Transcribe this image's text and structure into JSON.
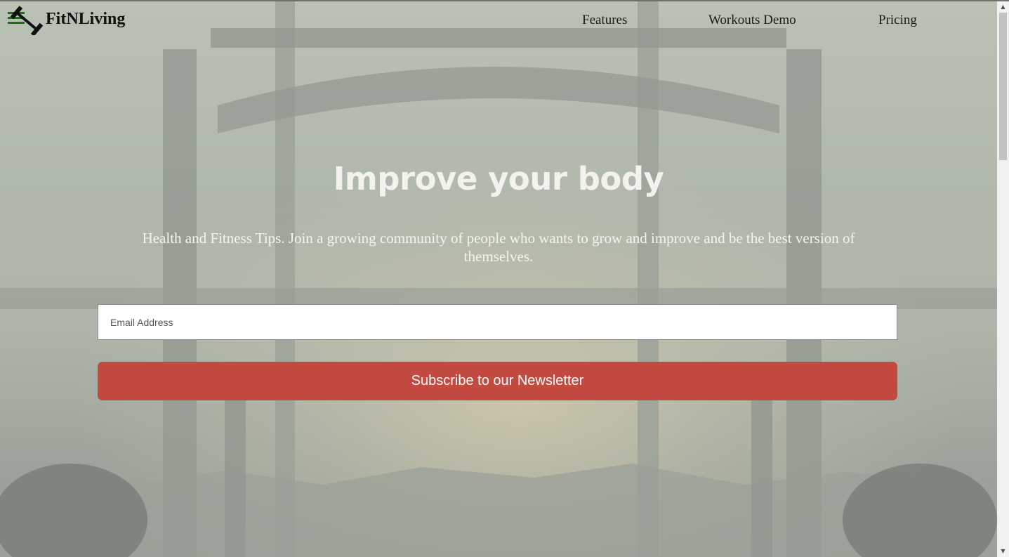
{
  "header": {
    "brand": "FitNLiving",
    "logo_icon": "dumbbell-logo-icon",
    "nav": [
      {
        "label": "Features"
      },
      {
        "label": "Workouts Demo"
      },
      {
        "label": "Pricing"
      }
    ]
  },
  "hero": {
    "title": "Improve your body",
    "subtitle": "Health and Fitness Tips. Join a growing community of people who wants to grow and improve and be the best version of themselves.",
    "email_placeholder": "Email Address",
    "subscribe_label": "Subscribe to our Newsletter"
  },
  "colors": {
    "accent": "#c34a41",
    "logo_green": "#1f6b1f"
  }
}
